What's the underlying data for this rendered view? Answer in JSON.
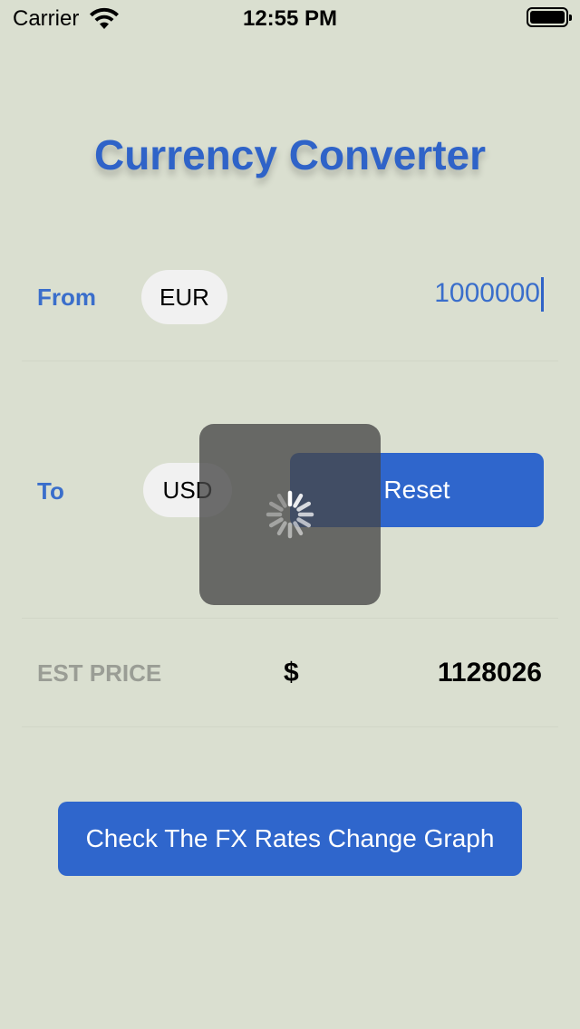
{
  "status_bar": {
    "carrier": "Carrier",
    "time": "12:55 PM",
    "wifi_icon": "wifi-icon",
    "battery_icon": "battery-icon"
  },
  "title": "Currency Converter",
  "from": {
    "label": "From",
    "currency": "EUR",
    "amount": "1000000"
  },
  "to": {
    "label": "To",
    "currency": "USD"
  },
  "reset_label": "Reset",
  "estimate": {
    "label": "EST PRICE",
    "symbol": "$",
    "value": "1128026"
  },
  "graph_button_label": "Check The FX Rates Change Graph",
  "loading_indicator": "activity-spinner-icon",
  "colors": {
    "background": "#dadfd0",
    "accent": "#2f66cc",
    "label_blue": "#3a6ecb",
    "muted_label": "#9a9d95"
  }
}
